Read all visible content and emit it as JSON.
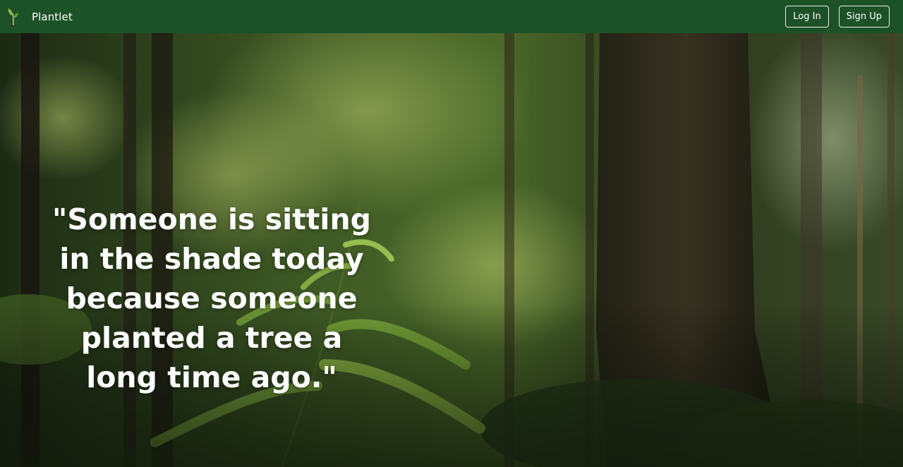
{
  "navbar": {
    "brand_name": "Plantlet",
    "logo_icon": "sprout-icon",
    "login_label": "Log In",
    "signup_label": "Sign Up",
    "background_color": "#1d5128"
  },
  "hero": {
    "background_image": "forest-with-fern-photo",
    "quote": "\"Someone is sitting in the shade today because someone planted a tree a long time ago.\""
  }
}
